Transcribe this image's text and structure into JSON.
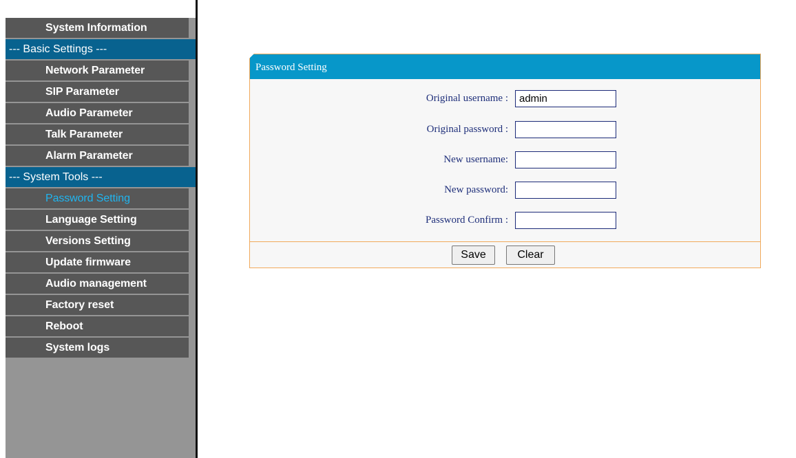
{
  "sidebar": {
    "items": [
      {
        "label": "System Information",
        "type": "link"
      },
      {
        "label": "--- Basic Settings ---",
        "type": "section"
      },
      {
        "label": "Network Parameter",
        "type": "link"
      },
      {
        "label": "SIP Parameter",
        "type": "link"
      },
      {
        "label": "Audio Parameter",
        "type": "link"
      },
      {
        "label": "Talk Parameter",
        "type": "link"
      },
      {
        "label": "Alarm Parameter",
        "type": "link"
      },
      {
        "label": "--- System Tools ---",
        "type": "section"
      },
      {
        "label": "Password Setting",
        "type": "link",
        "active": true
      },
      {
        "label": "Language Setting",
        "type": "link"
      },
      {
        "label": "Versions Setting",
        "type": "link"
      },
      {
        "label": "Update firmware",
        "type": "link"
      },
      {
        "label": "Audio management",
        "type": "link"
      },
      {
        "label": "Factory reset",
        "type": "link"
      },
      {
        "label": "Reboot",
        "type": "link"
      },
      {
        "label": "System logs",
        "type": "link"
      }
    ]
  },
  "panel": {
    "title": "Password Setting",
    "fields": [
      {
        "label": "Original username :",
        "value": "admin"
      },
      {
        "label": "Original password :",
        "value": ""
      },
      {
        "label": "New username:",
        "value": ""
      },
      {
        "label": "New password:",
        "value": ""
      },
      {
        "label": "Password Confirm :",
        "value": ""
      }
    ],
    "save_label": "Save",
    "clear_label": "Clear"
  },
  "colors": {
    "sidebar_bg": "#959595",
    "sidebar_item": "#575757",
    "sidebar_section": "#08628f",
    "active_text": "#1fb5f0",
    "panel_header": "#0797c9",
    "panel_border": "#f1a95a",
    "label_text": "#1f2f7a"
  }
}
